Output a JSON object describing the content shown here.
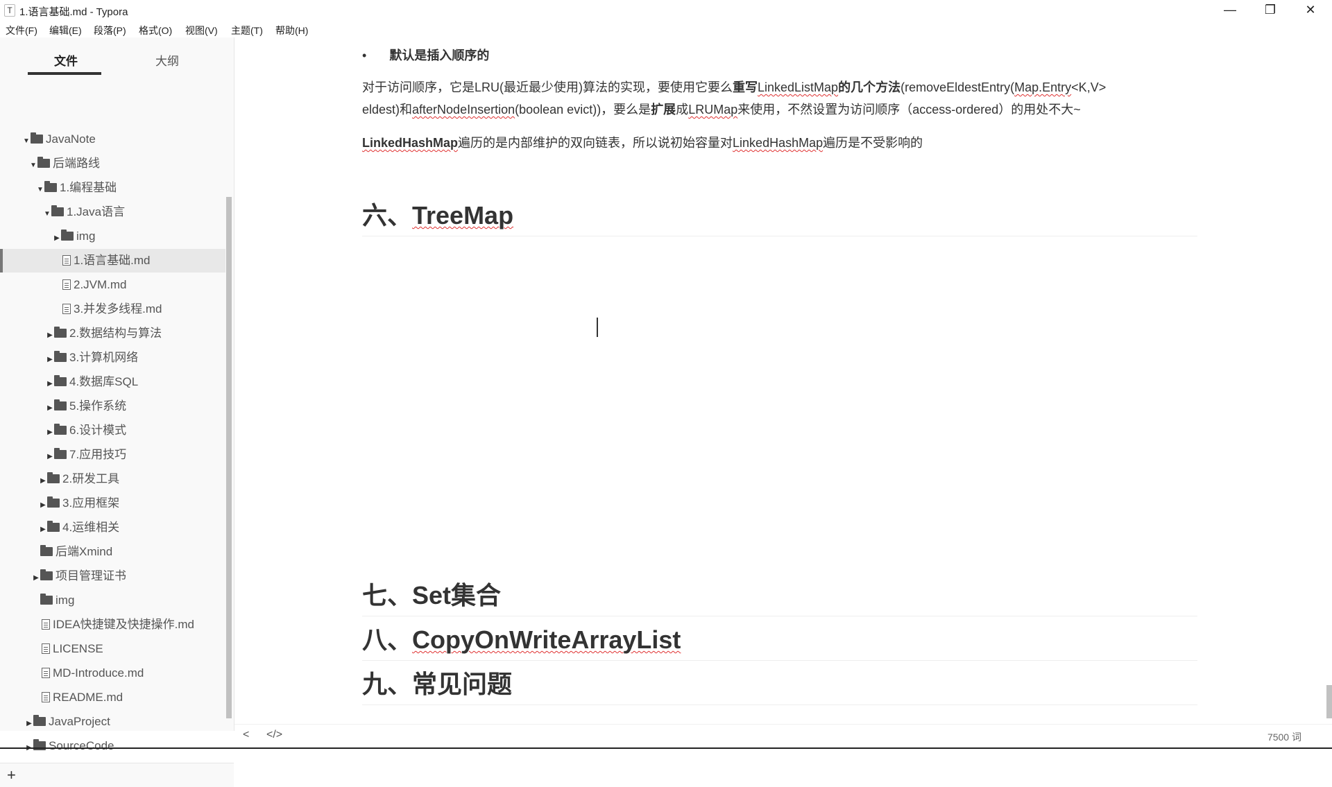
{
  "window": {
    "title": "1.语言基础.md - Typora",
    "icon": "T",
    "controls": {
      "minimize": "—",
      "restore": "❐",
      "close": "✕"
    }
  },
  "menu": [
    "文件(F)",
    "编辑(E)",
    "段落(P)",
    "格式(O)",
    "视图(V)",
    "主题(T)",
    "帮助(H)"
  ],
  "sidebar": {
    "tabs": [
      "文件",
      "大纲"
    ],
    "active_tab": "文件",
    "tree": [
      {
        "label": "JavaNote",
        "type": "folder",
        "expanded": true
      },
      {
        "label": "后端路线",
        "type": "folder",
        "expanded": true
      },
      {
        "label": "1.编程基础",
        "type": "folder",
        "expanded": true
      },
      {
        "label": "1.Java语言",
        "type": "folder",
        "expanded": true
      },
      {
        "label": "img",
        "type": "folder",
        "expanded": false
      },
      {
        "label": "1.语言基础.md",
        "type": "file",
        "selected": true
      },
      {
        "label": "2.JVM.md",
        "type": "file"
      },
      {
        "label": "3.并发多线程.md",
        "type": "file"
      },
      {
        "label": "2.数据结构与算法",
        "type": "folder",
        "expanded": false
      },
      {
        "label": "3.计算机网络",
        "type": "folder",
        "expanded": false
      },
      {
        "label": "4.数据库SQL",
        "type": "folder",
        "expanded": false
      },
      {
        "label": "5.操作系统",
        "type": "folder",
        "expanded": false
      },
      {
        "label": "6.设计模式",
        "type": "folder",
        "expanded": false
      },
      {
        "label": "7.应用技巧",
        "type": "folder",
        "expanded": false
      },
      {
        "label": "2.研发工具",
        "type": "folder",
        "expanded": false
      },
      {
        "label": "3.应用框架",
        "type": "folder",
        "expanded": false
      },
      {
        "label": "4.运维相关",
        "type": "folder",
        "expanded": false
      },
      {
        "label": "后端Xmind",
        "type": "folder"
      },
      {
        "label": "项目管理证书",
        "type": "folder",
        "expanded": false
      },
      {
        "label": "img",
        "type": "folder"
      },
      {
        "label": "IDEA快捷键及快捷操作.md",
        "type": "file"
      },
      {
        "label": "LICENSE",
        "type": "file"
      },
      {
        "label": "MD-Introduce.md",
        "type": "file"
      },
      {
        "label": "README.md",
        "type": "file"
      },
      {
        "label": "JavaProject",
        "type": "folder",
        "expanded": false
      },
      {
        "label": "SourceCode",
        "type": "folder",
        "expanded": false
      }
    ],
    "add_label": "+"
  },
  "editor": {
    "bullet_text": "默认是插入顺序的",
    "para1": {
      "a": "对于访问顺序，它是LRU(最近最少使用)算法的实现，要使用它要么",
      "b": "重写",
      "c": "LinkedListMap",
      "d": "的几个方法",
      "e": "(removeEldestEntry(",
      "f": "Map.Entry",
      "g": "<K,V>",
      "h": "eldest)和",
      "i": "afterNodeInsertion",
      "j": "(boolean evict))，要么是",
      "k": "扩展",
      "l": "成",
      "m": "LRUMap",
      "n": "来使用，不然设置为访问顺序（access-ordered）的用处不大~"
    },
    "para2": {
      "a": "LinkedHashMap",
      "b": "遍历的是内部维护的双向链表，所以说初始容量对",
      "c": "LinkedHashMap",
      "d": "遍历是不受影响的"
    },
    "headings": {
      "h6_prefix": "六、",
      "h6_name": "TreeMap",
      "h7": "七、Set集合",
      "h8_prefix": "八、",
      "h8_name": "CopyOnWriteArrayList",
      "h9": "九、常见问题"
    }
  },
  "footer": {
    "back": "<",
    "source": "</>",
    "word_count": "7500 词"
  }
}
